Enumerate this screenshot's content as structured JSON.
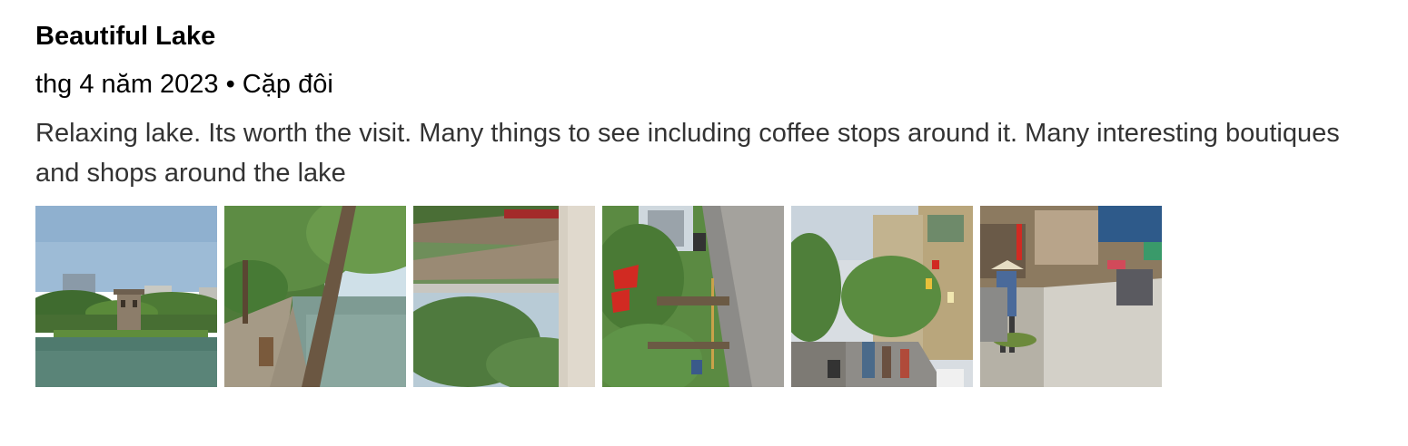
{
  "review": {
    "title": "Beautiful Lake",
    "meta": "thg 4 năm 2023 • Cặp đôi",
    "body": "Relaxing lake. Its worth the visit. Many things to see including coffee stops around it. Many interesting boutiques and shops around the lake"
  },
  "photos": [
    {
      "name": "lake-pagoda-photo"
    },
    {
      "name": "lakeside-path-photo"
    },
    {
      "name": "rotated-trees-photo"
    },
    {
      "name": "rotated-street-flags-photo"
    },
    {
      "name": "street-traffic-photo"
    },
    {
      "name": "street-vendor-photo"
    }
  ]
}
